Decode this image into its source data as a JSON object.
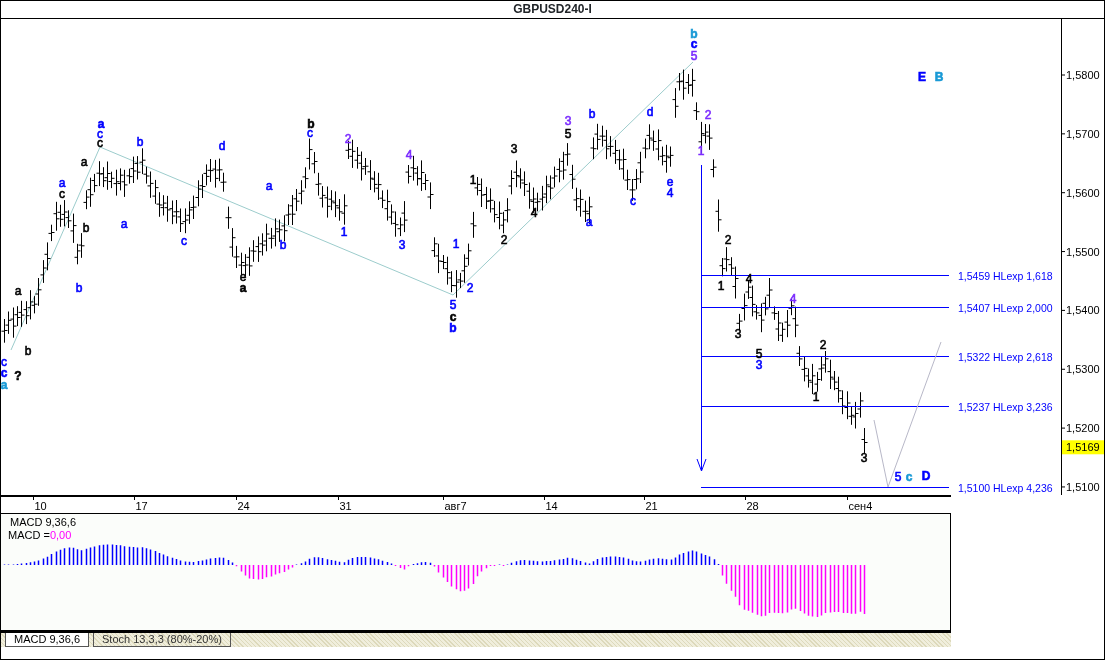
{
  "title": "GBPUSD240-I",
  "wave_labels": [
    {
      "text": "c",
      "color": "#0000ff",
      "kind": "minor"
    },
    {
      "text": "c",
      "color": "#0000ff",
      "kind": "major"
    },
    {
      "text": "a",
      "color": "#1a9ad6",
      "kind": "major"
    },
    {
      "text": "?",
      "color": "#000000",
      "kind": "major"
    },
    {
      "text": "a",
      "color": "#000000",
      "kind": "minor"
    },
    {
      "text": "b",
      "color": "#000000",
      "kind": "minor"
    },
    {
      "text": "a",
      "color": "#0000ff",
      "kind": "minor"
    },
    {
      "text": "c",
      "color": "#000000",
      "kind": "minor"
    },
    {
      "text": "a",
      "color": "#000000",
      "kind": "minor"
    },
    {
      "text": "a",
      "color": "#0000ff",
      "kind": "major"
    },
    {
      "text": "c",
      "color": "#0000ff",
      "kind": "minor"
    },
    {
      "text": "c",
      "color": "#000000",
      "kind": "minor"
    },
    {
      "text": "b",
      "color": "#000000",
      "kind": "minor"
    },
    {
      "text": "b",
      "color": "#0000ff",
      "kind": "minor"
    },
    {
      "text": "b",
      "color": "#0000ff",
      "kind": "minor"
    },
    {
      "text": "a",
      "color": "#0000ff",
      "kind": "minor"
    },
    {
      "text": "c",
      "color": "#0000ff",
      "kind": "minor"
    },
    {
      "text": "d",
      "color": "#0000ff",
      "kind": "minor"
    },
    {
      "text": "e",
      "color": "#000000",
      "kind": "minor"
    },
    {
      "text": "a",
      "color": "#000000",
      "kind": "major"
    },
    {
      "text": "a",
      "color": "#0000ff",
      "kind": "minor"
    },
    {
      "text": "b",
      "color": "#0000ff",
      "kind": "minor"
    },
    {
      "text": "b",
      "color": "#000000",
      "kind": "major"
    },
    {
      "text": "c",
      "color": "#0000ff",
      "kind": "minor"
    },
    {
      "text": "2",
      "color": "#7b2cff",
      "kind": "minor"
    },
    {
      "text": "1",
      "color": "#0000ff",
      "kind": "minor"
    },
    {
      "text": "4",
      "color": "#7b2cff",
      "kind": "minor"
    },
    {
      "text": "3",
      "color": "#0000ff",
      "kind": "minor"
    },
    {
      "text": "1",
      "color": "#0000ff",
      "kind": "minor"
    },
    {
      "text": "2",
      "color": "#0000ff",
      "kind": "minor"
    },
    {
      "text": "5",
      "color": "#0000ff",
      "kind": "minor"
    },
    {
      "text": "c",
      "color": "#000000",
      "kind": "major"
    },
    {
      "text": "b",
      "color": "#0000ff",
      "kind": "major"
    },
    {
      "text": "1",
      "color": "#000000",
      "kind": "minor"
    },
    {
      "text": "2",
      "color": "#000000",
      "kind": "minor"
    },
    {
      "text": "3",
      "color": "#000000",
      "kind": "minor"
    },
    {
      "text": "4",
      "color": "#000000",
      "kind": "minor"
    },
    {
      "text": "3",
      "color": "#7b2cff",
      "kind": "minor"
    },
    {
      "text": "5",
      "color": "#000000",
      "kind": "minor"
    },
    {
      "text": "b",
      "color": "#0000ff",
      "kind": "minor"
    },
    {
      "text": "a",
      "color": "#0000ff",
      "kind": "minor"
    },
    {
      "text": "c",
      "color": "#0000ff",
      "kind": "minor"
    },
    {
      "text": "d",
      "color": "#0000ff",
      "kind": "minor"
    },
    {
      "text": "e",
      "color": "#0000ff",
      "kind": "minor"
    },
    {
      "text": "4",
      "color": "#0000ff",
      "kind": "minor"
    },
    {
      "text": "b",
      "color": "#1a9ad6",
      "kind": "major"
    },
    {
      "text": "c",
      "color": "#0000ff",
      "kind": "major"
    },
    {
      "text": "5",
      "color": "#7b2cff",
      "kind": "minor"
    },
    {
      "text": "2",
      "color": "#7b2cff",
      "kind": "minor"
    },
    {
      "text": "1",
      "color": "#7b2cff",
      "kind": "minor"
    },
    {
      "text": "2",
      "color": "#000000",
      "kind": "minor"
    },
    {
      "text": "1",
      "color": "#000000",
      "kind": "minor"
    },
    {
      "text": "4",
      "color": "#000000",
      "kind": "minor"
    },
    {
      "text": "3",
      "color": "#000000",
      "kind": "minor"
    },
    {
      "text": "4",
      "color": "#7b2cff",
      "kind": "minor"
    },
    {
      "text": "5",
      "color": "#000000",
      "kind": "minor"
    },
    {
      "text": "3",
      "color": "#0000ff",
      "kind": "minor"
    },
    {
      "text": "2",
      "color": "#000000",
      "kind": "minor"
    },
    {
      "text": "1",
      "color": "#000000",
      "kind": "minor"
    },
    {
      "text": "3",
      "color": "#000000",
      "kind": "minor"
    },
    {
      "text": "5",
      "color": "#0000ff",
      "kind": "minor"
    },
    {
      "text": "c",
      "color": "#1a9ad6",
      "kind": "major"
    },
    {
      "text": "D",
      "color": "#0000ff",
      "kind": "major"
    },
    {
      "text": "E",
      "color": "#0000ff",
      "kind": "major"
    },
    {
      "text": "B",
      "color": "#1a9ad6",
      "kind": "major"
    }
  ],
  "levels": [
    {
      "text": "1,5459 HLexp 1,618"
    },
    {
      "text": "1,5407 HLexp 2,000"
    },
    {
      "text": "1,5322 HLexp 2,618"
    },
    {
      "text": "1,5237 HLexp 3,236"
    },
    {
      "text": "1,5100 HLexp 4,236"
    }
  ],
  "price_axis": {
    "ticks": [
      "1,5800",
      "1,5700",
      "1,5600",
      "1,5500",
      "1,5400",
      "1,5300",
      "1,5200",
      "1,5100"
    ],
    "current_price": "1,5169"
  },
  "date_axis": {
    "ticks": [
      "10",
      "17",
      "24",
      "31",
      "авг7",
      "14",
      "21",
      "28",
      "сен4"
    ]
  },
  "macd": {
    "title": "MACD 9,36,6",
    "value_label": "MACD =",
    "value": "0,00"
  },
  "tabs": [
    {
      "label": "MACD 9,36,6",
      "selected": true
    },
    {
      "label": "Stoch 13,3,3 (80%-20%)",
      "selected": false
    }
  ]
}
